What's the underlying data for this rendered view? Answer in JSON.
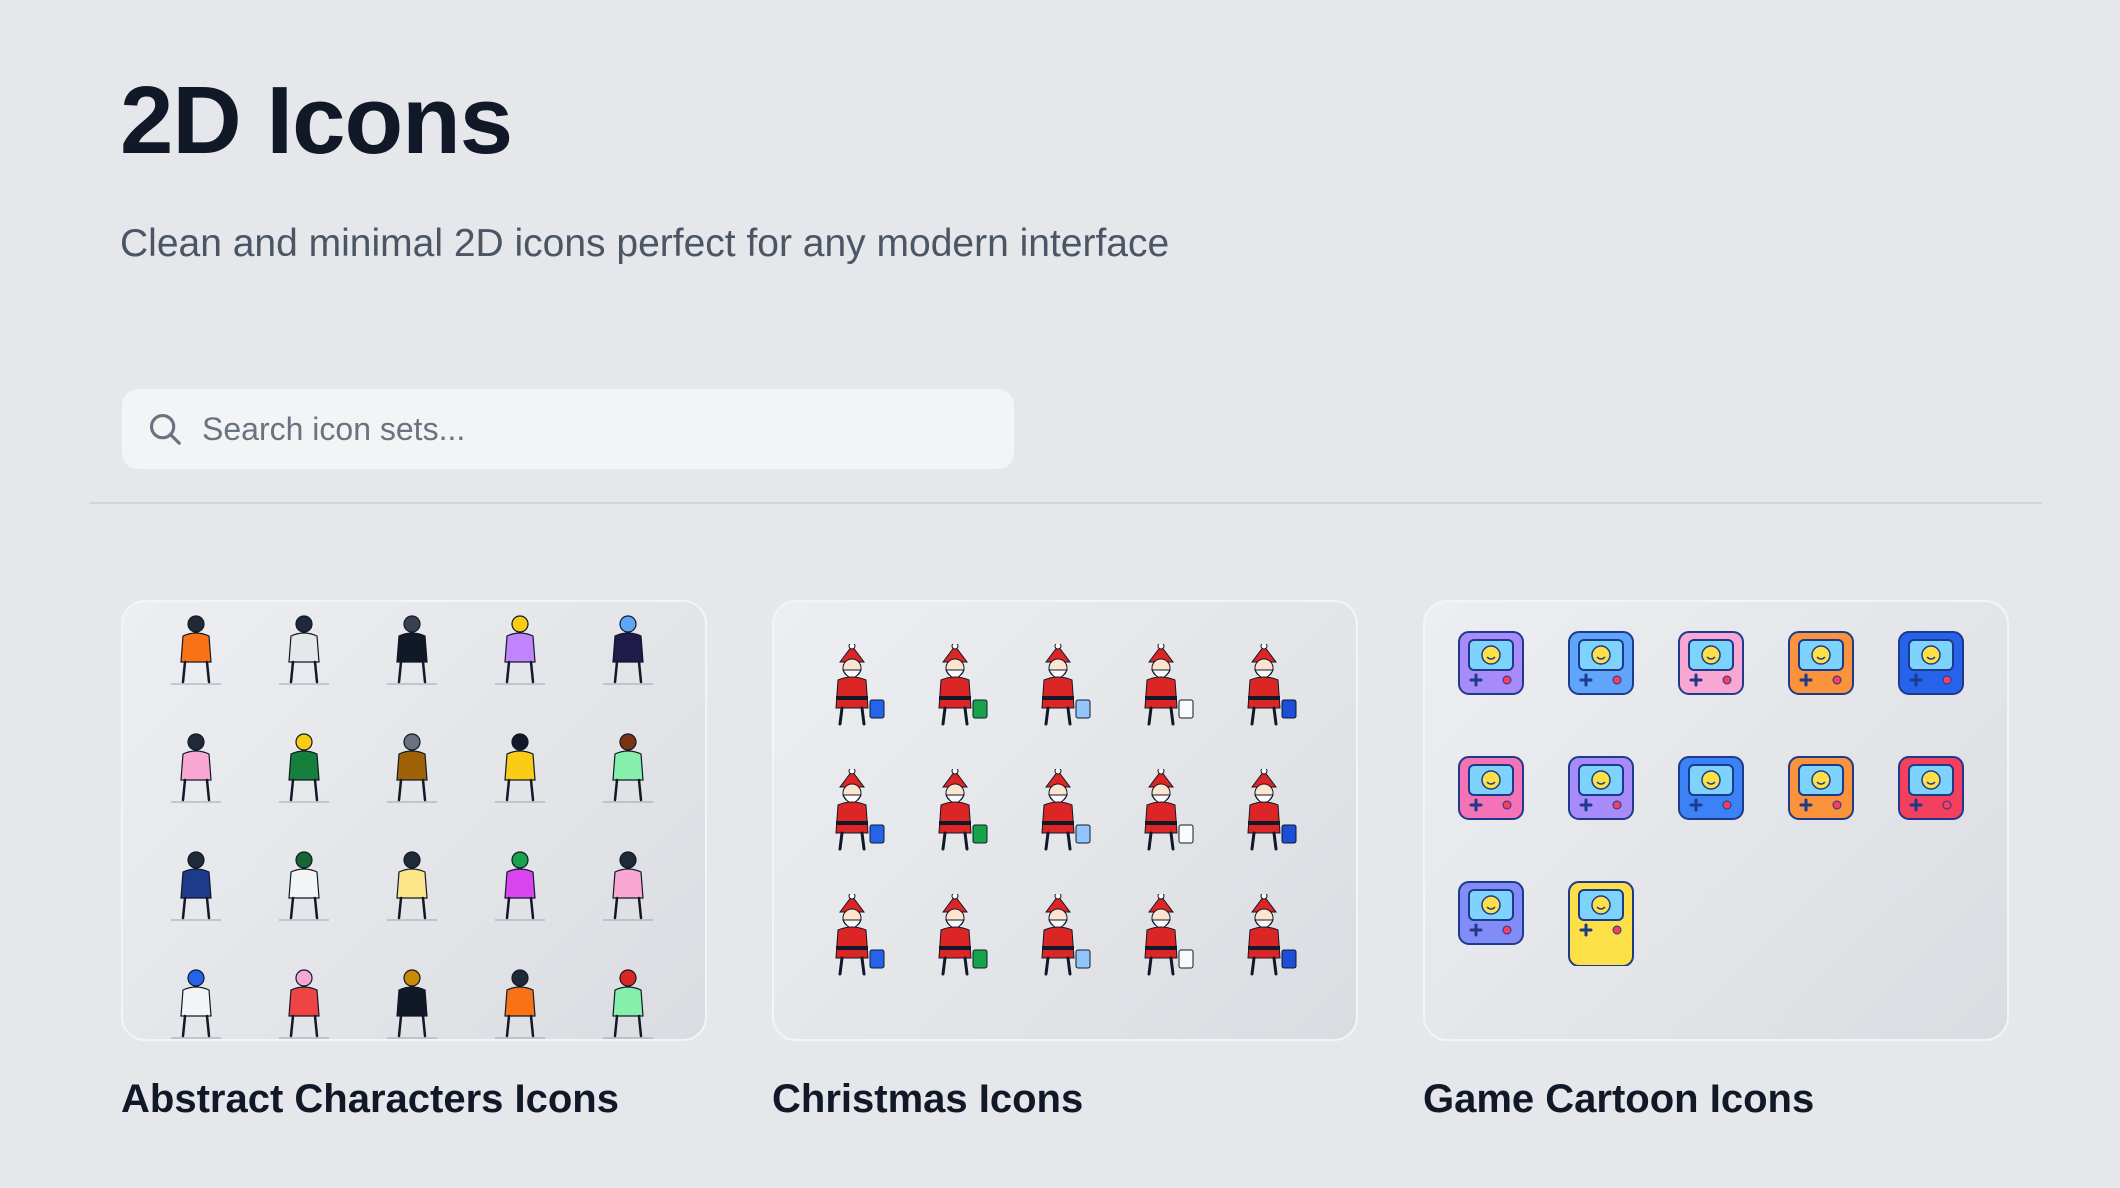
{
  "page": {
    "title": "2D Icons",
    "subtitle": "Clean and minimal 2D icons perfect for any modern interface"
  },
  "search": {
    "placeholder": "Search icon sets...",
    "icon": "search-icon"
  },
  "cards": [
    {
      "title": "Abstract Characters Icons"
    },
    {
      "title": "Christmas Icons"
    },
    {
      "title": "Game Cartoon Icons"
    }
  ]
}
